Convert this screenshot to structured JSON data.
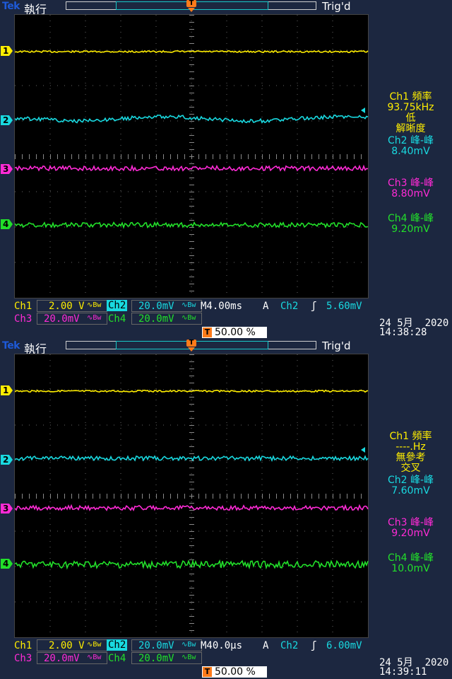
{
  "colors": {
    "ch1": "#ffee00",
    "ch2": "#19d9e0",
    "ch3": "#ff2bd6",
    "ch4": "#22e02a",
    "trigger": "#ff7b1a",
    "brand": "#1e5ad8",
    "panel": "#1c2740",
    "grid": "#666666"
  },
  "screens": [
    {
      "brand": "Tek",
      "mode": "執行",
      "trig_status": "Trig'd",
      "trig_glyph": "T",
      "channels": [
        {
          "num": "1",
          "name": "Ch1",
          "scale": "2.00 V",
          "coupling": "∿Bw"
        },
        {
          "num": "2",
          "name": "Ch2",
          "scale": "20.0mV",
          "coupling": "∿Bw"
        },
        {
          "num": "3",
          "name": "Ch3",
          "scale": "20.0mV",
          "coupling": "∿Bw"
        },
        {
          "num": "4",
          "name": "Ch4",
          "scale": "20.0mV",
          "coupling": "∿Bw"
        }
      ],
      "timebase": "M4.00ms",
      "acq": "A",
      "trig_source": "Ch2",
      "trig_slope": "ʃ",
      "trig_level": "5.60mV",
      "trig_position": "50.00 %",
      "date": "24 5月  2020",
      "time": "14:38:28",
      "measurements": [
        {
          "label": "Ch1 頻率",
          "value": "93.75kHz",
          "note": "低",
          "note2": "解晰度"
        },
        {
          "label": "Ch2 峰-峰",
          "value": "8.40mV"
        },
        {
          "label": "Ch3 峰-峰",
          "value": "8.80mV"
        },
        {
          "label": "Ch4 峰-峰",
          "value": "9.20mV"
        }
      ]
    },
    {
      "brand": "Tek",
      "mode": "執行",
      "trig_status": "Trig'd",
      "trig_glyph": "T",
      "channels": [
        {
          "num": "1",
          "name": "Ch1",
          "scale": "2.00 V",
          "coupling": "∿Bw"
        },
        {
          "num": "2",
          "name": "Ch2",
          "scale": "20.0mV",
          "coupling": "∿Bw"
        },
        {
          "num": "3",
          "name": "Ch3",
          "scale": "20.0mV",
          "coupling": "∿Bw"
        },
        {
          "num": "4",
          "name": "Ch4",
          "scale": "20.0mV",
          "coupling": "∿Bw"
        }
      ],
      "timebase": "M40.0µs",
      "acq": "A",
      "trig_source": "Ch2",
      "trig_slope": "ʃ",
      "trig_level": "6.00mV",
      "trig_position": "50.00 %",
      "date": "24 5月  2020",
      "time": "14:39:11",
      "measurements": [
        {
          "label": "Ch1 頻率",
          "value": "----.Hz",
          "note": "無參考",
          "note2": "交叉"
        },
        {
          "label": "Ch2 峰-峰",
          "value": "7.60mV"
        },
        {
          "label": "Ch3 峰-峰",
          "value": "9.20mV"
        },
        {
          "label": "Ch4 峰-峰",
          "value": "10.0mV"
        }
      ]
    }
  ]
}
